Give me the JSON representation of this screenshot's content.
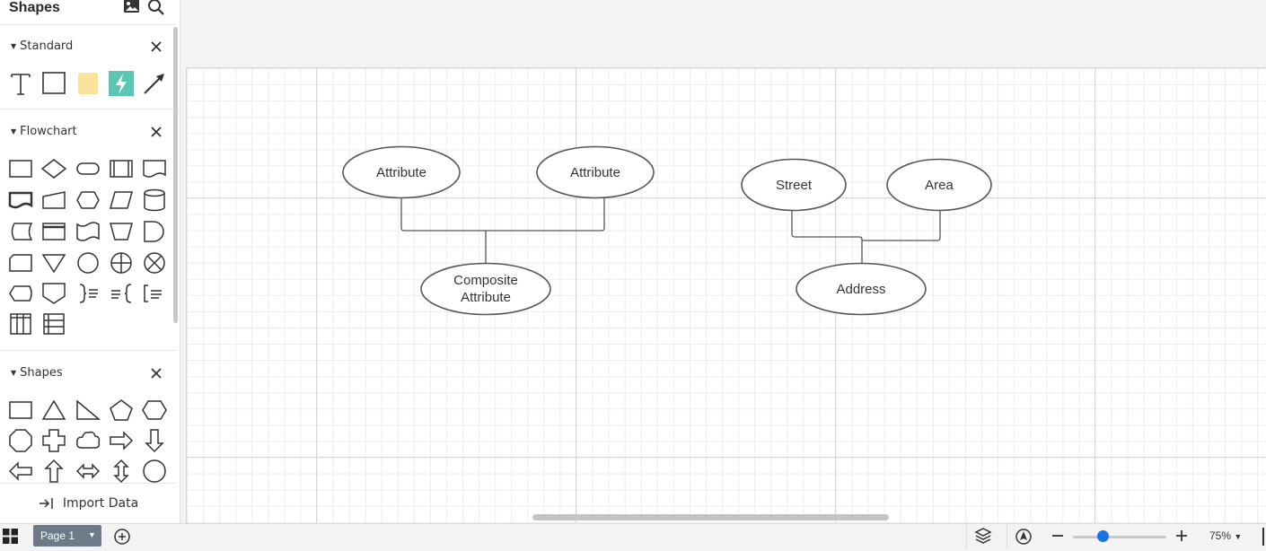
{
  "sidebar": {
    "title": "Shapes",
    "sections": [
      {
        "label": "Standard"
      },
      {
        "label": "Flowchart"
      },
      {
        "label": "Shapes"
      }
    ],
    "import_label": "Import Data"
  },
  "diagram": {
    "left_group": {
      "top_left": "Attribute",
      "top_right": "Attribute",
      "bottom_line1": "Composite",
      "bottom_line2": "Attribute"
    },
    "right_group": {
      "top_left": "Street",
      "top_right": "Area",
      "bottom": "Address"
    }
  },
  "bottom": {
    "page_tab": "Page 1",
    "zoom": "75%"
  },
  "colors": {
    "accent": "#1a73e8",
    "page_tab_bg": "#6c7a89",
    "lightning_bg": "#5cc6b4",
    "sticky": "#fbe39c"
  }
}
